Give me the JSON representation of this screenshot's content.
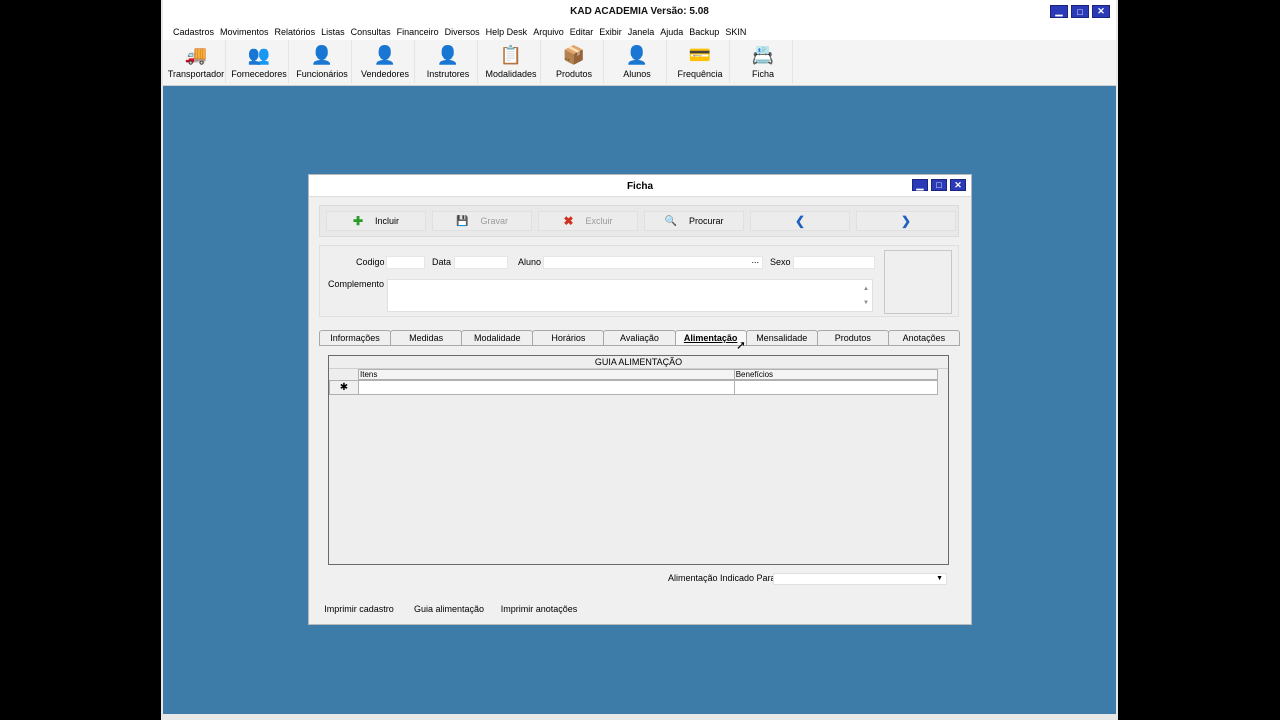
{
  "app": {
    "title": "KAD ACADEMIA     Versão: 5.08",
    "menu": [
      "Cadastros",
      "Movimentos",
      "Relatórios",
      "Listas",
      "Consultas",
      "Financeiro",
      "Diversos",
      "Help Desk",
      "Arquivo",
      "Editar",
      "Exibir",
      "Janela",
      "Ajuda",
      "Backup",
      "SKIN"
    ],
    "toolbar": [
      {
        "label": "Transportador",
        "icon": "truck-icon",
        "glyph": "🚚"
      },
      {
        "label": "Fornecedores",
        "icon": "suppliers-icon",
        "glyph": "👥"
      },
      {
        "label": "Funcionários",
        "icon": "employee-icon",
        "glyph": "👤"
      },
      {
        "label": "Vendedores",
        "icon": "seller-icon",
        "glyph": "👤"
      },
      {
        "label": "Instrutores",
        "icon": "instructor-icon",
        "glyph": "👤"
      },
      {
        "label": "Modalidades",
        "icon": "clipboard-icon",
        "glyph": "📋"
      },
      {
        "label": "Produtos",
        "icon": "box-icon",
        "glyph": "📦"
      },
      {
        "label": "Alunos",
        "icon": "student-icon",
        "glyph": "👤"
      },
      {
        "label": "Frequência",
        "icon": "card-icon",
        "glyph": "💳"
      },
      {
        "label": "Ficha",
        "icon": "form-icon",
        "glyph": "📇"
      }
    ],
    "window_buttons": [
      "▁",
      "□",
      "✕"
    ]
  },
  "ficha": {
    "title": "Ficha",
    "window_buttons": [
      "▁",
      "□",
      "✕"
    ],
    "actions": [
      {
        "label": "Incluir",
        "icon": "plus-icon",
        "glyph": "✚",
        "color": "#2a9a2a",
        "enabled": true
      },
      {
        "label": "Gravar",
        "icon": "save-icon",
        "glyph": "💾",
        "color": "#3a4aa0",
        "enabled": false
      },
      {
        "label": "Excluir",
        "icon": "delete-icon",
        "glyph": "✖",
        "color": "#d03020",
        "enabled": false
      },
      {
        "label": "Procurar",
        "icon": "search-icon",
        "glyph": "🔍",
        "color": "#555555",
        "enabled": true
      },
      {
        "label": "",
        "icon": "prev-icon",
        "glyph": "❮",
        "color": "#2060c0",
        "enabled": true
      },
      {
        "label": "",
        "icon": "next-icon",
        "glyph": "❯",
        "color": "#2060c0",
        "enabled": true
      }
    ],
    "fields": {
      "codigo_label": "Codigo",
      "data_label": "Data",
      "aluno_label": "Aluno",
      "aluno_browse": "...",
      "sexo_label": "Sexo",
      "complemento_label": "Complemento"
    },
    "tabs": [
      {
        "label": "Informações",
        "active": false
      },
      {
        "label": "Medidas",
        "active": false
      },
      {
        "label": "Modalidade",
        "active": false
      },
      {
        "label": "Horários",
        "active": false
      },
      {
        "label": "Avaliação",
        "active": false
      },
      {
        "label": "Alimentação",
        "active": true
      },
      {
        "label": "Mensalidade",
        "active": false
      },
      {
        "label": "Produtos",
        "active": false
      },
      {
        "label": "Anotações",
        "active": false
      }
    ],
    "grid": {
      "title": "GUIA ALIMENTAÇÃO",
      "columns": [
        "Itens",
        "Benefícios"
      ],
      "new_row_marker": "✱"
    },
    "indicado_label": "Alimentação Indicado Para",
    "bottom_buttons": [
      "Imprimir cadastro",
      "Guia alimentação",
      "Imprimir anotações"
    ]
  }
}
